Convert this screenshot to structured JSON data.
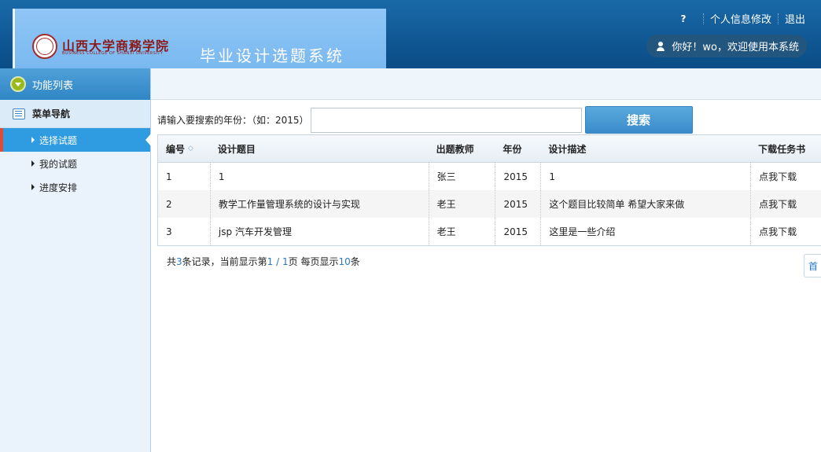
{
  "header": {
    "logo_text": "山西大学商務学院",
    "logo_sub": "BUSINESS COLLEGE OF SHANXI UNIVERSITY",
    "system_title": "毕业设计选题系统",
    "help_icon": "?",
    "profile_link": "个人信息修改",
    "logout_link": "退出",
    "welcome": "你好！wo，欢迎使用本系统"
  },
  "sidebar": {
    "title": "功能列表",
    "nav_title": "菜单导航",
    "items": [
      {
        "label": "选择试题",
        "active": true
      },
      {
        "label": "我的试题",
        "active": false
      },
      {
        "label": "进度安排",
        "active": false
      }
    ]
  },
  "search": {
    "label": "请输入要搜索的年份：（如：2015）",
    "value": "",
    "placeholder": "",
    "button": "搜索"
  },
  "table": {
    "headers": [
      "编号",
      "设计题目",
      "出题教师",
      "年份",
      "设计描述",
      "下载任务书"
    ],
    "sort_icon": "◇",
    "rows": [
      [
        "1",
        "1",
        "张三",
        "2015",
        "1",
        "点我下载"
      ],
      [
        "2",
        "教学工作量管理系统的设计与实现",
        "老王",
        "2015",
        "这个题目比较简单 希望大家来做",
        "点我下载"
      ],
      [
        "3",
        "jsp 汽车开发管理",
        "老王",
        "2015",
        "这里是一些介绍",
        "点我下载"
      ]
    ]
  },
  "pager": {
    "prefix": "共",
    "total": "3",
    "mid1": "条记录，当前显示第",
    "current": "1",
    "slash": " / ",
    "pages": "1",
    "mid2": "页 每页显示",
    "per_page": "10",
    "suffix": "条",
    "first_button": "首"
  },
  "colors": {
    "header_bg": "#0f5793",
    "banner_bg": "#8fc6f6",
    "active_item": "#2f9be0",
    "search_button": "#3a8ccb"
  }
}
